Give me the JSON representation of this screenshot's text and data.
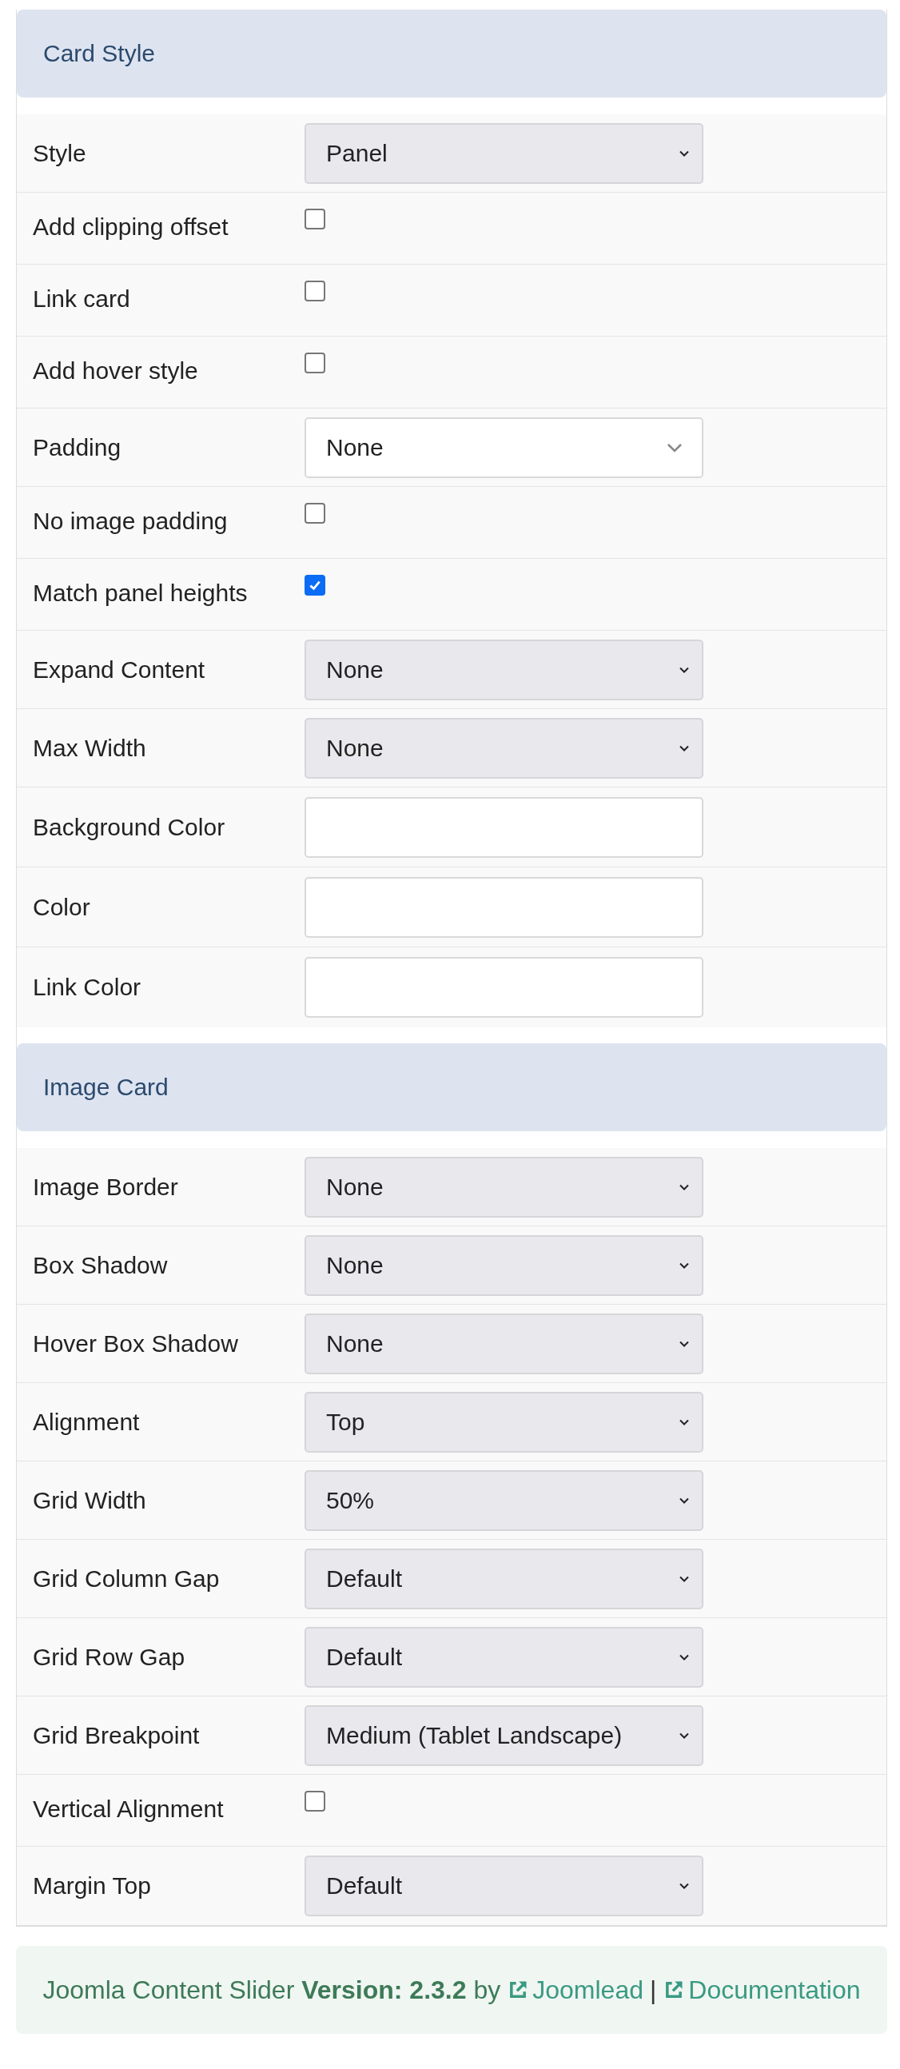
{
  "sections": [
    {
      "title": "Card Style",
      "fields": [
        {
          "kind": "select",
          "label": "Style",
          "value": "Panel"
        },
        {
          "kind": "checkbox",
          "label": "Add clipping offset",
          "checked": false
        },
        {
          "kind": "checkbox",
          "label": "Link card",
          "checked": false
        },
        {
          "kind": "checkbox",
          "label": "Add hover style",
          "checked": false
        },
        {
          "kind": "dropdown",
          "label": "Padding",
          "value": "None"
        },
        {
          "kind": "checkbox",
          "label": "No image padding",
          "checked": false
        },
        {
          "kind": "checkbox",
          "label": "Match panel heights",
          "checked": true
        },
        {
          "kind": "select",
          "label": "Expand Content",
          "value": "None"
        },
        {
          "kind": "select",
          "label": "Max Width",
          "value": "None"
        },
        {
          "kind": "text",
          "label": "Background Color"
        },
        {
          "kind": "text",
          "label": "Color"
        },
        {
          "kind": "text",
          "label": "Link Color"
        }
      ]
    },
    {
      "title": "Image Card",
      "fields": [
        {
          "kind": "select",
          "label": "Image Border",
          "value": "None"
        },
        {
          "kind": "select",
          "label": "Box Shadow",
          "value": "None"
        },
        {
          "kind": "select",
          "label": "Hover Box Shadow",
          "value": "None"
        },
        {
          "kind": "select",
          "label": "Alignment",
          "value": "Top"
        },
        {
          "kind": "select",
          "label": "Grid Width",
          "value": "50%"
        },
        {
          "kind": "select",
          "label": "Grid Column Gap",
          "value": "Default"
        },
        {
          "kind": "select",
          "label": "Grid Row Gap",
          "value": "Default"
        },
        {
          "kind": "select",
          "label": "Grid Breakpoint",
          "value": "Medium (Tablet Landscape)"
        },
        {
          "kind": "checkbox",
          "label": "Vertical Alignment",
          "checked": false
        },
        {
          "kind": "select",
          "label": "Margin Top",
          "value": "Default"
        }
      ]
    }
  ],
  "footer": {
    "text": "Joomla Content Slider **Version: 2.3.2** by",
    "links": [
      "Joomlead",
      "Documentation"
    ],
    "separator": "|"
  }
}
